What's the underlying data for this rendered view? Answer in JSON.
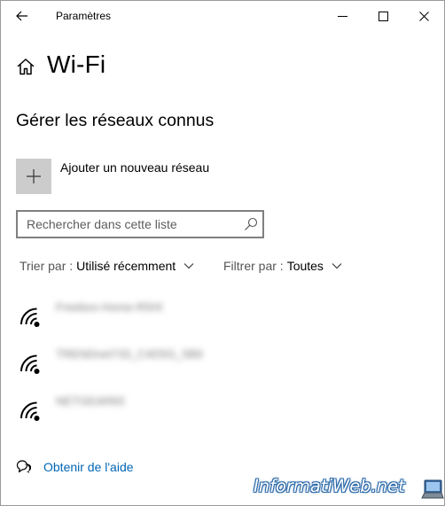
{
  "window": {
    "title": "Paramètres"
  },
  "header": {
    "page_title": "Wi-Fi",
    "section_title": "Gérer les réseaux connus"
  },
  "add_network": {
    "label": "Ajouter un nouveau réseau"
  },
  "search": {
    "placeholder": "Rechercher dans cette liste",
    "value": ""
  },
  "sort": {
    "prefix": "Trier par :",
    "value": "Utilisé récemment"
  },
  "filter": {
    "prefix": "Filtrer par :",
    "value": "Toutes"
  },
  "networks": [
    {
      "name": "Freebox-Home-R5Hl",
      "icon": "wifi-icon"
    },
    {
      "name": "TRENDnet733_C4D5G_5B9",
      "icon": "wifi-icon"
    },
    {
      "name": "NETGEAR83",
      "icon": "wifi-icon"
    }
  ],
  "help": {
    "label": "Obtenir de l'aide"
  },
  "watermark": {
    "text": "InformatiWeb.net"
  },
  "colors": {
    "link": "#0066b4",
    "add_tile": "#cccccc",
    "search_border": "#808080"
  }
}
